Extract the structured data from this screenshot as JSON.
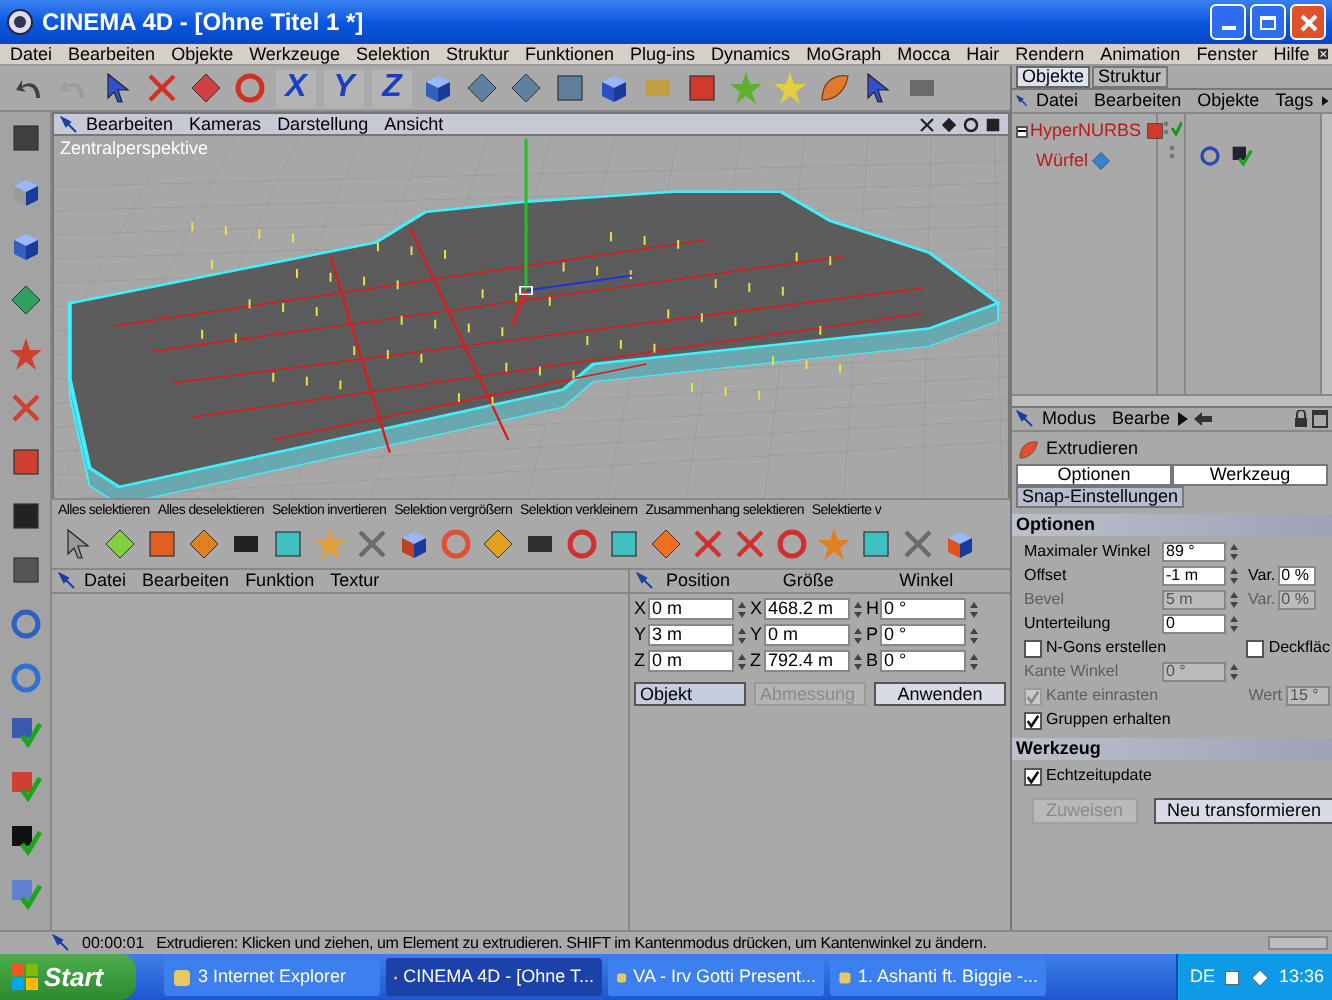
{
  "window": {
    "title": "CINEMA 4D - [Ohne Titel 1 *]"
  },
  "menu_bar": [
    "Datei",
    "Bearbeiten",
    "Objekte",
    "Werkzeuge",
    "Selektion",
    "Struktur",
    "Funktionen",
    "Plug-ins",
    "Dynamics",
    "MoGraph",
    "Mocca",
    "Hair",
    "Rendern",
    "Animation",
    "Fenster",
    "Hilfe"
  ],
  "toolbar": {
    "axis_locks": [
      "X",
      "Y",
      "Z"
    ]
  },
  "viewport": {
    "menu": [
      "Bearbeiten",
      "Kameras",
      "Darstellung",
      "Ansicht"
    ],
    "camera": "Zentralperspektive"
  },
  "command_bar": [
    "Alles selektieren",
    "Alles deselektieren",
    "Selektion invertieren",
    "Selektion vergrößern",
    "Selektion verkleinern",
    "Zusammenhang selektieren",
    "Selektierte v"
  ],
  "material_manager": {
    "menu": [
      "Datei",
      "Bearbeiten",
      "Funktion",
      "Textur"
    ]
  },
  "coordinates": {
    "headers": [
      "Position",
      "Größe",
      "Winkel"
    ],
    "rows": [
      {
        "pos_axis": "X",
        "position": "0 m",
        "size_axis": "X",
        "size": "468.2 m",
        "angle_axis": "H",
        "angle": "0 °"
      },
      {
        "pos_axis": "Y",
        "position": "3 m",
        "size_axis": "Y",
        "size": "0 m",
        "angle_axis": "P",
        "angle": "0 °"
      },
      {
        "pos_axis": "Z",
        "position": "0 m",
        "size_axis": "Z",
        "size": "792.4 m",
        "angle_axis": "B",
        "angle": "0 °"
      }
    ],
    "mode": "Objekt",
    "size_mode": {
      "label": "Abmessung",
      "disabled": true
    },
    "apply": "Anwenden"
  },
  "status_bar": {
    "time": "00:00:01",
    "message": "Extrudieren: Klicken und ziehen, um Element zu extrudieren. SHIFT im Kantenmodus drücken, um Kantenwinkel zu ändern."
  },
  "object_manager": {
    "tabs": [
      {
        "label": "Objekte",
        "selected": true
      },
      {
        "label": "Struktur",
        "selected": false
      }
    ],
    "menu": [
      "Datei",
      "Bearbeiten",
      "Objekte",
      "Tags"
    ],
    "tree": [
      {
        "name": "HyperNURBS",
        "expanded": true,
        "children": [
          {
            "name": "Würfel"
          }
        ]
      }
    ]
  },
  "attributes": {
    "menu": [
      "Modus",
      "Bearbe"
    ],
    "tool": "Extrudieren",
    "tabs": [
      {
        "label": "Optionen",
        "selected": true
      },
      {
        "label": "Werkzeug",
        "selected": true
      },
      {
        "label": "Snap-Einstellungen",
        "selected": false
      }
    ],
    "sections": [
      {
        "title": "Optionen",
        "rows": [
          {
            "kind": "field",
            "label": "Maximaler Winkel",
            "value": "89 °",
            "disabled": false
          },
          {
            "kind": "field",
            "label": "Offset",
            "value": "-1 m",
            "var_label": "Var.",
            "var_value": "0 %",
            "disabled": false
          },
          {
            "kind": "field",
            "label": "Bevel",
            "value": "5 m",
            "var_label": "Var.",
            "var_value": "0 %",
            "disabled": true
          },
          {
            "kind": "field",
            "label": "Unterteilung",
            "value": "0",
            "disabled": false
          },
          {
            "kind": "checks",
            "items": [
              {
                "label": "N-Gons erstellen",
                "checked": false,
                "disabled": false
              },
              {
                "label": "Deckfläc",
                "checked": false,
                "disabled": false
              }
            ]
          },
          {
            "kind": "field",
            "label": "Kante Winkel",
            "value": "0 °",
            "disabled": true
          },
          {
            "kind": "check_field",
            "label": "Kante einrasten",
            "checked": true,
            "disabled": true,
            "field_label": "Wert",
            "value": "15 °"
          },
          {
            "kind": "checks",
            "items": [
              {
                "label": "Gruppen erhalten",
                "checked": true,
                "disabled": false
              }
            ]
          }
        ]
      },
      {
        "title": "Werkzeug",
        "rows": [
          {
            "kind": "checks",
            "items": [
              {
                "label": "Echtzeitupdate",
                "checked": true,
                "disabled": false
              }
            ]
          },
          {
            "kind": "buttons",
            "items": [
              {
                "label": "Zuweisen",
                "disabled": true
              },
              {
                "label": "Neu transformieren",
                "disabled": false
              }
            ]
          }
        ]
      }
    ]
  },
  "taskbar": {
    "start": "Start",
    "tasks": [
      {
        "label": "3 Internet Explorer",
        "selected": false
      },
      {
        "label": "CINEMA 4D - [Ohne T...",
        "selected": true
      },
      {
        "label": "VA - Irv Gotti Present...",
        "selected": false
      },
      {
        "label": "1. Ashanti ft. Biggie -...",
        "selected": false
      }
    ],
    "language": "DE",
    "clock": "13:36"
  }
}
